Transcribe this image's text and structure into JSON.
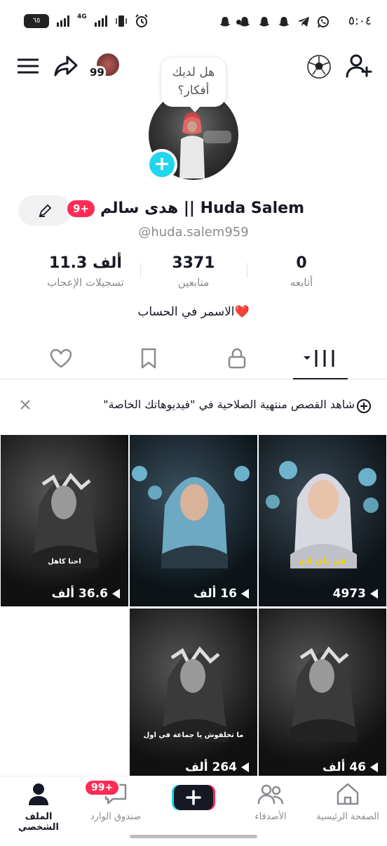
{
  "status_bar": {
    "time": "٥:٠٤",
    "battery": "٦٥",
    "network": "4G"
  },
  "header": {
    "notification_count": "99"
  },
  "bubble": {
    "line1": "هل لديك",
    "line2": "أفكار؟"
  },
  "profile": {
    "name": "هدى سالم || Huda Salem",
    "badge": "9+",
    "handle": "@huda.salem959",
    "bio": "الاسمر في الحساب❤️"
  },
  "stats": [
    {
      "num": "0",
      "label": "أتابعه"
    },
    {
      "num": "3371",
      "label": "متابعين"
    },
    {
      "num": "11.3 ألف",
      "label": "تسجيلات الإعجاب"
    }
  ],
  "banner": {
    "text": "شاهد القصص منتهية الصلاحية في \"فيديوهاتك الخاصة\""
  },
  "videos": [
    {
      "views": "4973",
      "caption": "في باي ادم"
    },
    {
      "views": "16 ألف",
      "caption": ""
    },
    {
      "views": "36.6 ألف",
      "caption": "احنا كاهل"
    },
    {
      "views": "46 ألف",
      "caption": ""
    },
    {
      "views": "264 ألف",
      "caption": "ما تخلفوش يا جماعة في اول"
    }
  ],
  "bottom_nav": {
    "home": "الصفحة الرئيسية",
    "friends": "الأصدقاء",
    "inbox": "صندوق الوارد",
    "inbox_badge": "99+",
    "profile": "الملف الشخصي"
  },
  "colors": {
    "accent_red": "#fe2c55",
    "accent_cyan": "#20d5ec"
  }
}
